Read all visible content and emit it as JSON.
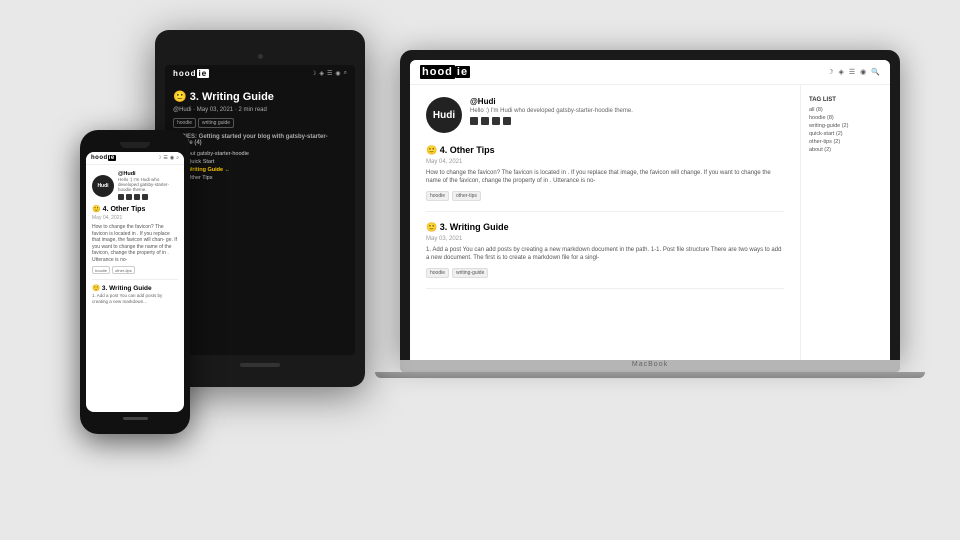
{
  "brand": {
    "name_prefix": "hood",
    "name_suffix": "ie"
  },
  "laptop": {
    "profile": {
      "avatar_text": "Hudi",
      "name": "@Hudi",
      "description": "Hello :) I'm Hudi who developed gatsby-starter-hoodie theme."
    },
    "post1": {
      "emoji": "🙂",
      "number": "4.",
      "title": "Other Tips",
      "date": "May 04, 2021",
      "text": "How to change the favicon? The favicon is located in . If you replace that image, the favicon will change. If you want to change the name of the favicon, change the property of in . Utterance is no-",
      "tags": [
        "hoodie",
        "other-tips"
      ]
    },
    "post2": {
      "emoji": "🙂",
      "number": "3.",
      "title": "Writing Guide",
      "date": "May 03, 2021",
      "text": "1. Add a post You can add posts by creating a new markdown document in the path. 1-1. Post file structure There are two ways to add a new document. The first is to create a markdown file for a singl-",
      "tags": [
        "hoodie",
        "writing-guide"
      ]
    },
    "taglist": {
      "title": "TAG LIST",
      "items": [
        "all (8)",
        "hoodie (8)",
        "writing-guide (2)",
        "quick-start (2)",
        "other-tips (2)",
        "about (2)"
      ]
    }
  },
  "tablet": {
    "post": {
      "emoji": "🙂",
      "number": "3.",
      "title": "Writing Guide",
      "author": "@Hudi",
      "date": "May 03, 2021",
      "read": "2 min read",
      "tags": [
        "hoodie",
        "writing guide"
      ],
      "series_title": "SERIES: Getting started your blog with gatsby-starter-hoodie (4)",
      "series_items": [
        {
          "label": "About gatsby-starter-hoodie",
          "color": "#888",
          "active": false
        },
        {
          "label": "2. Quick Start",
          "color": "#888",
          "active": false
        },
        {
          "label": "3. Writing Guide ←",
          "color": "#ffcc00",
          "active": true
        },
        {
          "label": "4. Other Tips",
          "color": "#888",
          "active": false
        }
      ]
    }
  },
  "phone": {
    "profile": {
      "avatar_text": "Hudi",
      "name": "@Hudi",
      "description": "Hello :) I'm Hudi who developed gatsby-starter-hoodie theme."
    },
    "post1": {
      "emoji": "🙂",
      "number": "4.",
      "title": "Other Tips",
      "date": "May 04, 2021",
      "text": "How to change the favicon? The favicon is located in . If you replace that image, the favicon will chan- ge. If you want to change the name of the favicon, change the property of in . Utterance is no-",
      "tags": [
        "hoodie",
        "other-tips"
      ]
    },
    "post2": {
      "emoji": "🙂",
      "number": "3.",
      "title": "Writing Guide",
      "text": "1. Add a post You can add posts by creating a new markdown..."
    }
  },
  "macbook_label": "MacBook"
}
